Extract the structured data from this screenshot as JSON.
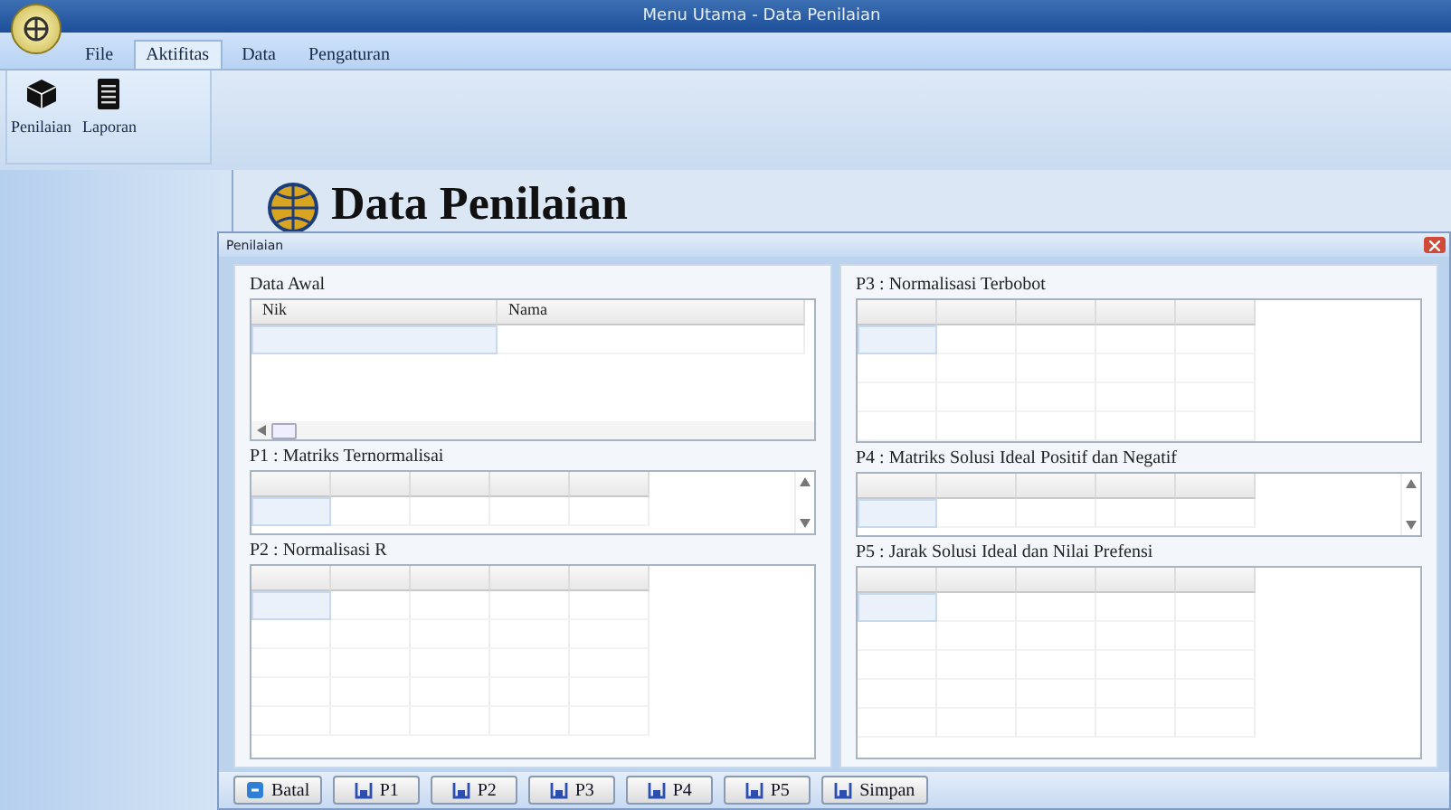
{
  "window": {
    "title": "Menu Utama - Data Penilaian"
  },
  "menu_tabs": [
    {
      "label": "File",
      "selected": false
    },
    {
      "label": "Aktifitas",
      "selected": true
    },
    {
      "label": "Data",
      "selected": false
    },
    {
      "label": "Pengaturan",
      "selected": false
    }
  ],
  "ribbon_buttons": [
    {
      "label": "Penilaian",
      "kind": "box"
    },
    {
      "label": "Laporan",
      "kind": "document"
    }
  ],
  "header": {
    "title": "Data Penilaian"
  },
  "child_window": {
    "title": "Penilaian",
    "left_groups": [
      {
        "title": "Data Awal",
        "columns": [
          "Nik",
          "Nama"
        ],
        "kind": "hscroll"
      },
      {
        "title": "P1 : Matriks Ternormalisai",
        "kind": "vscroll"
      },
      {
        "title": "P2 : Normalisasi R",
        "kind": "plain"
      }
    ],
    "right_groups": [
      {
        "title": "P3 : Normalisasi Terbobot",
        "kind": "plain"
      },
      {
        "title": "P4 : Matriks Solusi Ideal Positif dan Negatif",
        "kind": "vscroll"
      },
      {
        "title": "P5 : Jarak Solusi Ideal dan Nilai Prefensi",
        "kind": "plain"
      }
    ],
    "buttons": [
      {
        "label": "Batal",
        "kind": "cancel"
      },
      {
        "label": "P1",
        "kind": "save"
      },
      {
        "label": "P2",
        "kind": "save"
      },
      {
        "label": "P3",
        "kind": "save"
      },
      {
        "label": "P4",
        "kind": "save"
      },
      {
        "label": "P5",
        "kind": "save"
      },
      {
        "label": "Simpan",
        "kind": "save"
      }
    ]
  }
}
